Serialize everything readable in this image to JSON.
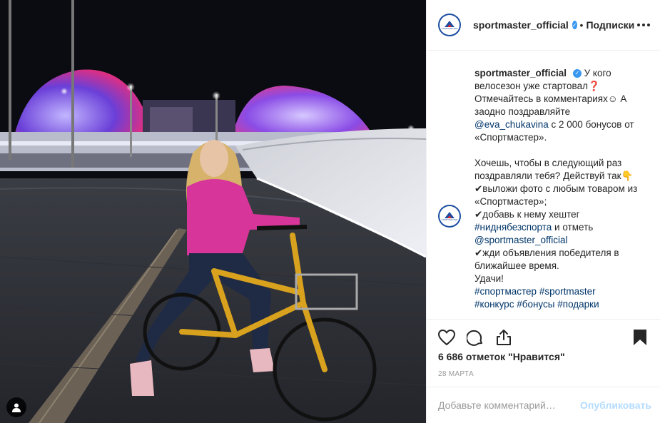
{
  "post": {
    "image_alt": "Девушка на велосипеде ночью у стадиона",
    "tag_icon": "user-tag-icon"
  },
  "header": {
    "username": "sportmaster_official",
    "separator": "•",
    "follow_label": "Подписки",
    "logo_text": "СПОРТМАСТЕР"
  },
  "caption": {
    "username": "sportmaster_official",
    "part1": "У кого велосезон уже стартовал❓ Отмечайтесь в комментариях☺ А заодно поздравляйте ",
    "mention1": "@eva_chukavina",
    "part2": " с 2 000 бонусов от «Спортмастер».",
    "part3": "Хочешь, чтобы в следующий раз поздравляли тебя? Действуй так👇\n✔выложи фото с любым товаром из «Спортмастер»;\n✔добавь к нему хештег ",
    "hashtag1": "#ниднябезспорта",
    "part4": " и отметь ",
    "mention2": "@sportmaster_official",
    "part5": "\n✔жди объявления победителя в ближайшее время.\nУдачи!\n",
    "hashtag2": "#спортмастер",
    "hashtag3": "#sportmaster",
    "hashtag4": "#конкурс",
    "hashtag5": "#бонусы",
    "hashtag6": "#подарки"
  },
  "actions": {
    "like_icon": "heart-icon",
    "comment_icon": "comment-icon",
    "share_icon": "share-icon",
    "save_icon": "bookmark-icon"
  },
  "likes_text": "6 686 отметок \"Нравится\"",
  "date_text": "28 марта",
  "comment_box": {
    "placeholder": "Добавьте комментарий…",
    "publish_label": "Опубликовать"
  },
  "colors": {
    "link": "#003569",
    "verified": "#3897f0",
    "brand": "#1c4ea1",
    "publish_disabled": "#b3dbff"
  }
}
